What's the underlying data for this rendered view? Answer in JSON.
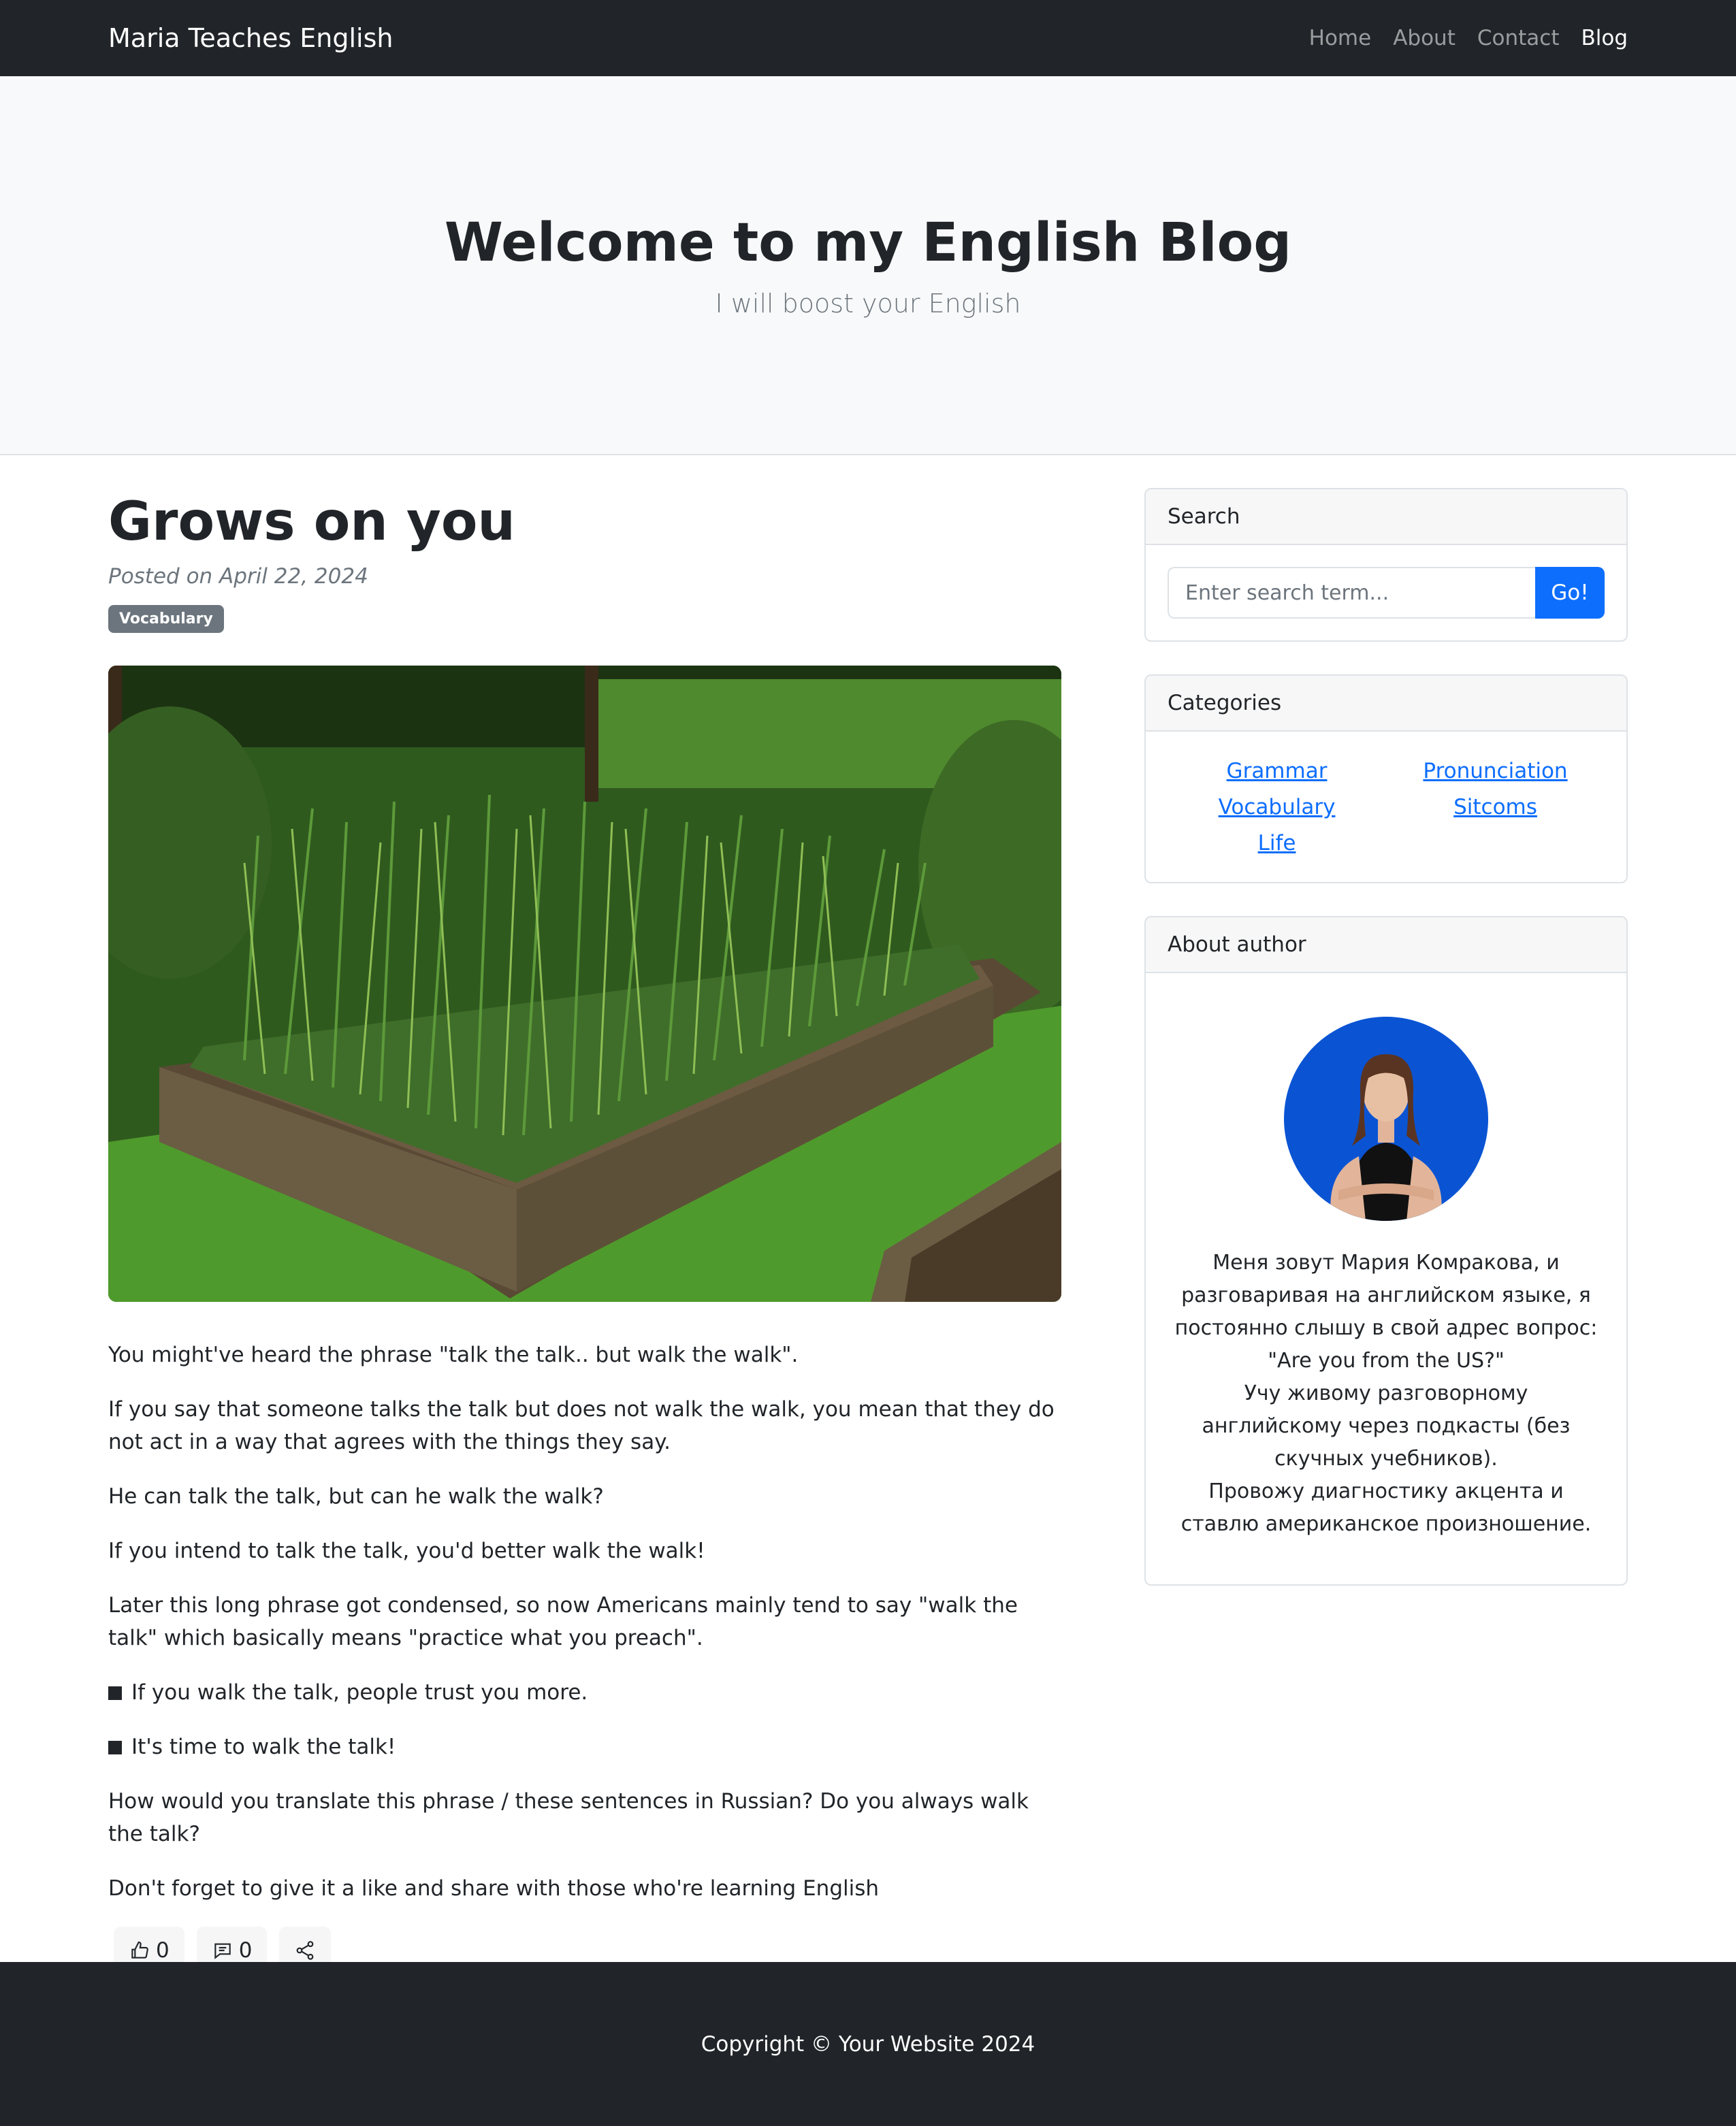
{
  "navbar": {
    "brand": "Maria Teaches English",
    "links": [
      "Home",
      "About",
      "Contact",
      "Blog"
    ]
  },
  "hero": {
    "title": "Welcome to my English Blog",
    "subtitle": "I will boost your English"
  },
  "post": {
    "title": "Grows on you",
    "posted": "Posted on April 22, 2024",
    "badge": "Vocabulary",
    "paragraphs": [
      "You might've heard the phrase \"talk the talk.. but walk the walk\".",
      "If you say that someone talks the talk but does not walk the walk, you mean that they do not act in a way that agrees with the things they say.",
      "He can talk the talk, but can he walk the walk?",
      "If you intend to talk the talk, you'd better walk the walk!",
      "Later this long phrase got condensed, so now Americans mainly tend to say \"walk the talk\" which basically means \"practice what you preach\".",
      "If you walk the talk, people trust you more.",
      "It's time to walk the talk!",
      "How would you translate this phrase / these sentences in Russian? Do you always walk the talk?",
      "Don't forget to give it a like and share with those who're learning English"
    ],
    "likes": "0",
    "comments": "0",
    "icons": {
      "like": "thumbs-up-icon",
      "comment": "comment-icon",
      "share": "share-icon"
    }
  },
  "sidebar": {
    "search": {
      "header": "Search",
      "placeholder": "Enter search term...",
      "button": "Go!"
    },
    "categories": {
      "header": "Categories",
      "left": [
        "Grammar",
        "Vocabulary",
        "Life"
      ],
      "right": [
        "Pronunciation",
        "Sitcoms"
      ]
    },
    "about": {
      "header": "About author",
      "bio": "Меня зовут Мария Комракова, и разговаривая на английском языке, я постоянно слышу в свой адрес вопрос: \"Are you from the US?\"\nУчу живому разговорному английскому через подкасты (без скучных учебников).\nПровожу диагностику акцента и ставлю американское произношение."
    }
  },
  "footer": {
    "text": "Copyright © Your Website 2024"
  },
  "colors": {
    "navbar_bg": "#212529",
    "hero_bg": "#f8f9fa",
    "link": "#0d6efd",
    "badge": "#6c757d"
  }
}
